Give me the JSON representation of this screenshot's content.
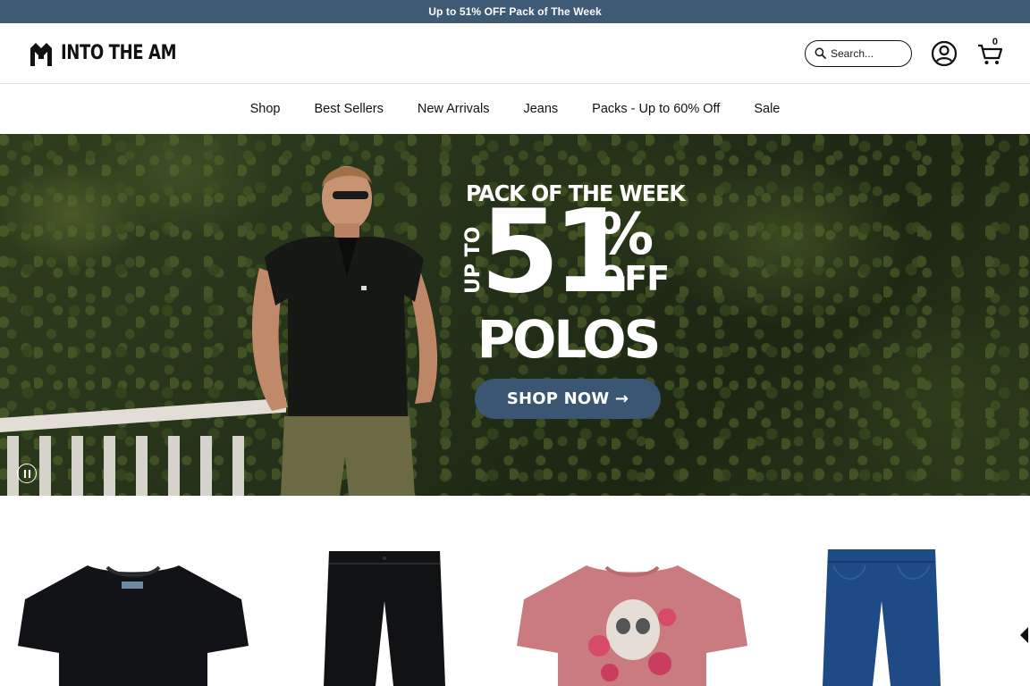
{
  "announcement": {
    "text": "Up to 51% OFF Pack of The Week"
  },
  "brand": {
    "name": "INTO THE AM"
  },
  "search": {
    "placeholder": "Search..."
  },
  "cart": {
    "count": "0"
  },
  "nav": {
    "items": [
      {
        "label": "Shop"
      },
      {
        "label": "Best Sellers"
      },
      {
        "label": "New Arrivals"
      },
      {
        "label": "Jeans"
      },
      {
        "label": "Packs - Up to 60% Off"
      },
      {
        "label": "Sale"
      }
    ]
  },
  "hero": {
    "line1": "PACK OF THE WEEK",
    "up_to": "UP TO",
    "number": "51",
    "percent": "%",
    "off": "OFF",
    "product": "POLOS",
    "cta": "SHOP NOW →"
  },
  "products": [
    {
      "name": "black t-shirt"
    },
    {
      "name": "black shorts"
    },
    {
      "name": "pink skull graphic t-shirt"
    },
    {
      "name": "blue jeans"
    }
  ],
  "colors": {
    "announce_bg": "#3f5a75",
    "cta_bg": "#3b5672"
  }
}
